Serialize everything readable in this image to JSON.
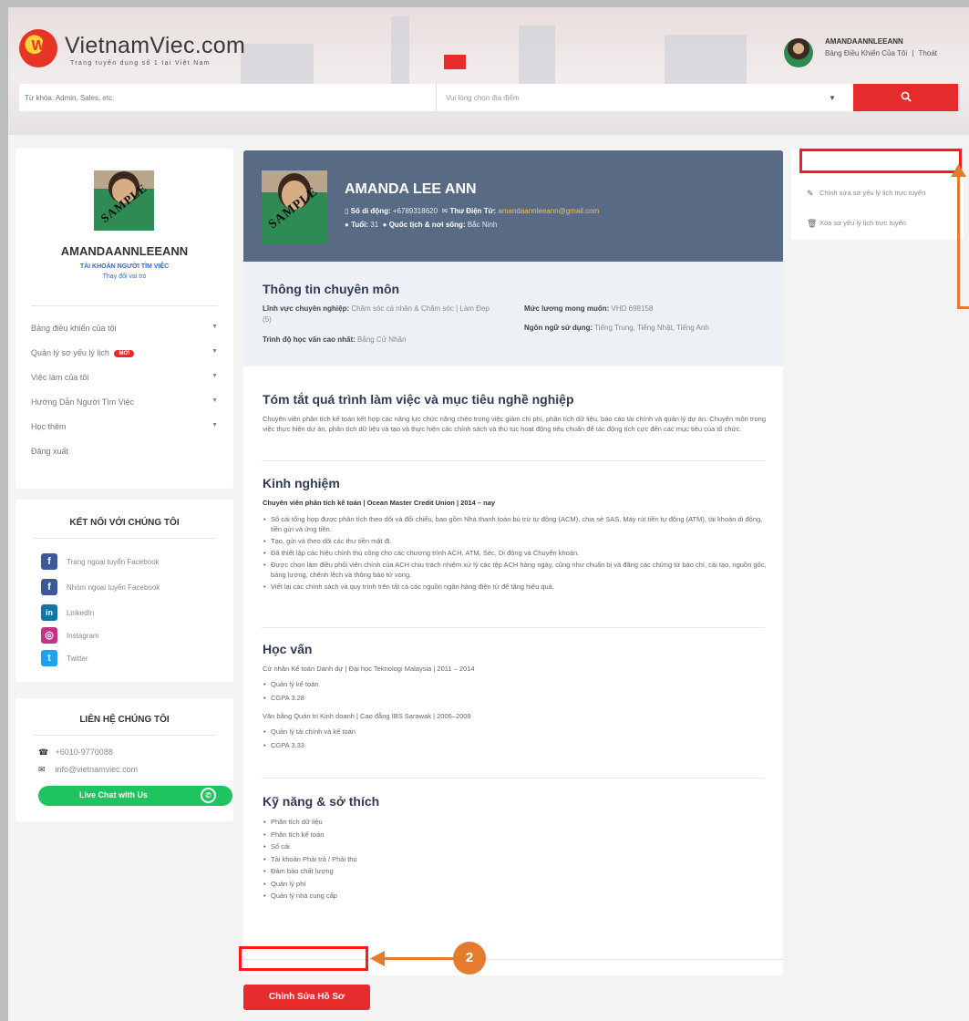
{
  "header": {
    "logo_letter": "W",
    "logo_text": "VietnamViec.com",
    "logo_tagline": "Trang tuyển dụng số 1 tại Việt Nam",
    "user_name": "AMANDAANNLEEANN",
    "dashboard_link": "Bảng Điều Khiển Của Tôi",
    "separator": "|",
    "logout_link": "Thoát",
    "keyword_placeholder": "Từ khóa: Admin, Sales, etc.",
    "location_placeholder": "Vui lòng chọn địa điểm",
    "caret": "▼",
    "search_icon": "search-icon"
  },
  "sidebar": {
    "photo_stamp": "SAMPLE",
    "name": "AMANDAANNLEEANN",
    "role": "TÀI KHOẢN NGƯỜI TÌM VIỆC",
    "switch_role": "Thay đổi vai trò",
    "menu": [
      {
        "label": "Bảng điều khiển của tôi"
      },
      {
        "label": "Quản lý sơ yếu lý lịch",
        "badge": "MỚI"
      },
      {
        "label": "Việc làm của tôi"
      },
      {
        "label": "Hướng Dẫn Người Tìm Việc"
      },
      {
        "label": "Học thêm"
      },
      {
        "label": "Đăng xuất"
      }
    ],
    "chevron": "▼"
  },
  "connect": {
    "title": "KẾT NỐI VỚI CHÚNG TÔI",
    "items": [
      {
        "label": "Trang ngoại tuyển Facebook",
        "icon": "facebook-icon",
        "glyph": "f",
        "color": "#3b5998"
      },
      {
        "label": "Nhóm ngoại tuyển Facebook",
        "icon": "facebook-icon",
        "glyph": "f",
        "color": "#3b5998"
      },
      {
        "label": "LinkedIn",
        "icon": "linkedin-icon",
        "glyph": "in",
        "color": "#0e76a8"
      },
      {
        "label": "Instagram",
        "icon": "instagram-icon",
        "glyph": "◎",
        "color": "#c13584"
      },
      {
        "label": "Twitter",
        "icon": "twitter-icon",
        "glyph": "t",
        "color": "#1da1f2"
      }
    ]
  },
  "contact": {
    "title": "LIÊN HỆ CHÚNG TÔI",
    "phone_icon": "☎",
    "phone": "+6010-9770088",
    "email_icon": "✉",
    "email": "info@vietnamviec.com",
    "chat_label": "Live Chat with Us",
    "chat_icon_glyph": "✆"
  },
  "resume": {
    "photo_stamp": "SAMPLE",
    "name": "AMANDA LEE ANN",
    "phone_label": "Số di động:",
    "phone_value": "+6789318620",
    "email_label": "Thư Điện Tử:",
    "email_value": "amandaannleeann@gmail.com",
    "age_label": "Tuổi:",
    "age_value": "31",
    "nationality_label": "Quốc tịch & nơi sống:",
    "nationality_value": "Bắc Ninh",
    "pro_title": "Thông tin chuyên môn",
    "field_label": "Lĩnh vực chuyên nghiệp:",
    "field_value": "Chăm sóc cá nhân & Chăm sóc | Làm Đẹp (5)",
    "salary_label": "Mức lương mong muốn:",
    "salary_value": "VHD 698158",
    "language_label": "Ngôn ngữ sử dụng:",
    "language_value": "Tiếng Trung, Tiếng Nhật, Tiếng Anh",
    "education_level_label": "Trình độ học vấn cao nhất:",
    "education_level_value": "Bằng Cử Nhân",
    "summary_title": "Tóm tắt quá trình làm việc và mục tiêu nghề nghiệp",
    "summary_text": "Chuyên viên phân tích kế toán kết hợp các năng lực chức năng chéo trong việc giảm chi phí, phân tích dữ liệu, báo cáo tài chính và quản lý dự án. Chuyên môn trong việc thực hiện dự án, phân tích dữ liệu và tạo và thực hiện các chính sách và thủ tục hoạt động tiêu chuẩn để tác động tích cực đến các mục tiêu của tổ chức.",
    "experience_title": "Kinh nghiệm",
    "experience_role": "Chuyên viên phân tích kế toán | Ocean Master Credit Union | 2014 – nay",
    "experience_bullets": [
      "Sổ cái tổng hợp được phân tích theo dõi và đối chiếu, bao gồm Nhà thanh toán bù trừ tự động (ACM), chia sẻ SAS, Máy rút tiền tự động (ATM), tài khoản di động, tiền gửi và ứng tiền.",
      "Tạo, gửi và theo dõi các thư tiền mặt đi.",
      "Đã thiết lập các hiệu chỉnh thủ công cho các chương trình ACH, ATM, Séc, Di động và Chuyển khoản.",
      "Được chọn làm điều phối viên chính của ACH chịu trách nhiệm xử lý các tệp ACH hàng ngày, cũng như chuẩn bị và đăng các chứng từ báo chí, cải tạo, nguồn gốc, bảng lương, chênh lệch và thông báo tử vong.",
      "Viết lại các chính sách và quy trình trên tất cả các nguồn ngân hàng điện tử để tăng hiệu quả."
    ],
    "education_title": "Học vấn",
    "education": [
      {
        "heading": "Cử nhân Kế toán Danh dự | Đại học Teknologi Malaysia | 2011 – 2014",
        "bullets": [
          "Quản lý kế toán",
          "CGPA 3.28"
        ]
      },
      {
        "heading": "Văn bằng Quản trị Kinh doanh | Cao đẳng IBS Sarawak | 2006–2009",
        "bullets": [
          "Quản lý tài chính và kế toán",
          "CGPA 3.33"
        ]
      }
    ],
    "skills_title": "Kỹ năng & sở thích",
    "skills": [
      "Phân tích dữ liệu",
      "Phân tích kế toán",
      "Sổ cái",
      "Tài khoản Phải trả / Phải thu",
      "Đảm bảo chất lượng",
      "Quản lý phí",
      "Quản lý nhà cung cấp"
    ],
    "edit_button": "Chỉnh Sửa Hồ Sơ"
  },
  "right_panel": {
    "items": [
      {
        "icon": "✎",
        "label": "Chỉnh sửa sơ yếu lý lịch trực tuyến"
      },
      {
        "icon": "🗑",
        "label": "Xóa sơ yếu lý lịch trực tuyến"
      }
    ]
  },
  "annotations": {
    "step_number": "2"
  },
  "colors": {
    "accent_red": "#e52b2b",
    "resume_header": "#586a84",
    "annotation_orange": "#e57b2c",
    "chat_green": "#1ec45e"
  }
}
